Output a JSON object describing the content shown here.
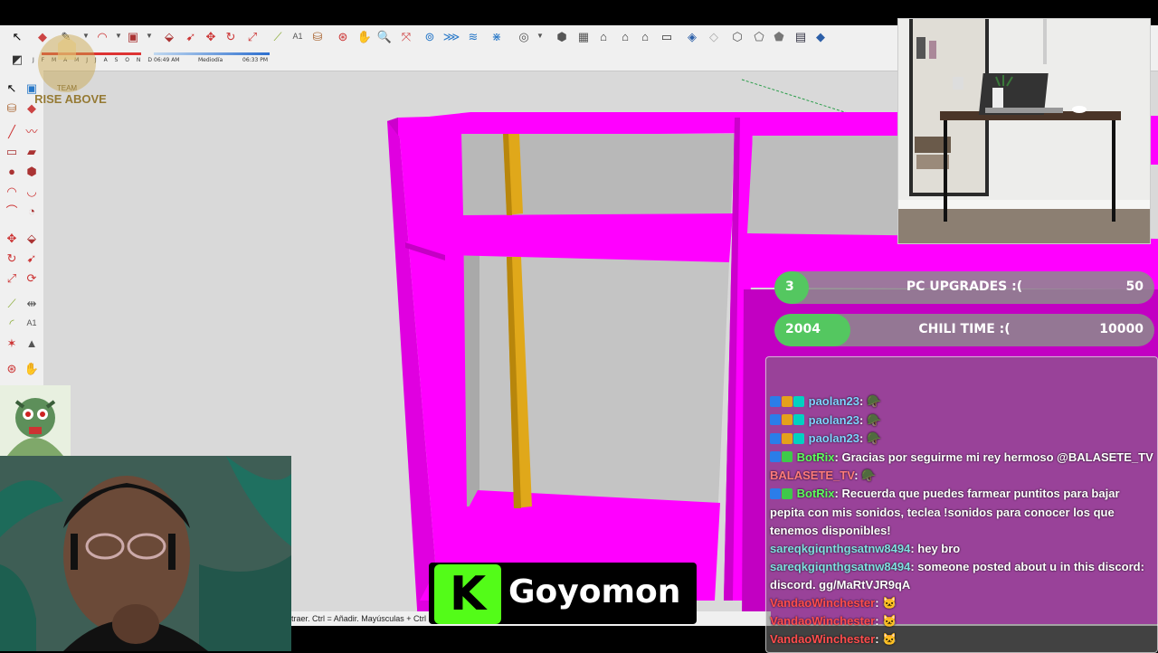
{
  "toolbar": {
    "shadow": {
      "months": "J F M A M J J A S O N D",
      "time_start": "06:49 AM",
      "time_mid": "Mediodía",
      "time_end": "06:33 PM"
    }
  },
  "status_bar": {
    "text": "traer. Ctrl = Añadir. Mayúsculas + Ctrl"
  },
  "overlay": {
    "team_logo": {
      "line1": "TEAM",
      "line2": "RISE ABOVE"
    },
    "goals": [
      {
        "current": "3",
        "title": "PC UPGRADES :(",
        "target": "50",
        "progress": 0.06
      },
      {
        "current": "2004",
        "title": "CHILI TIME :(",
        "target": "10000",
        "progress": 0.2
      }
    ],
    "sponsor": {
      "logo_letter": "K",
      "name": "Goyomon"
    }
  },
  "chat": {
    "messages": [
      {
        "user": "paolan23",
        "text": "",
        "color": "#7fd3ff",
        "badges": [
          "#2b7de9",
          "#e4a11b",
          "#00d1c1"
        ],
        "emote": "🪖"
      },
      {
        "user": "paolan23",
        "text": "",
        "color": "#7fd3ff",
        "badges": [
          "#2b7de9",
          "#e4a11b",
          "#00d1c1"
        ],
        "emote": "🪖"
      },
      {
        "user": "paolan23",
        "text": "",
        "color": "#7fd3ff",
        "badges": [
          "#2b7de9",
          "#e4a11b",
          "#00d1c1"
        ],
        "emote": "🪖"
      },
      {
        "user": "BotRix",
        "text": "Gracias por seguirme mi rey hermoso @BALASETE_TV",
        "color": "#5cff5c",
        "badges": [
          "#2b7de9",
          "#3ec94a"
        ],
        "emote": ""
      },
      {
        "user": "BALASETE_TV",
        "text": "",
        "color": "#ff7b7b",
        "badges": [],
        "emote": "🪖"
      },
      {
        "user": "BotRix",
        "text": "Recuerda que puedes farmear puntitos para bajar pepita con mis sonidos, teclea !sonidos para conocer los que tenemos disponibles!",
        "color": "#5cff5c",
        "badges": [
          "#2b7de9",
          "#3ec94a"
        ],
        "emote": ""
      },
      {
        "user": "sareqkgiqnthgsatnw8494",
        "text": "hey bro",
        "color": "#7fe0e0",
        "badges": [],
        "emote": ""
      },
      {
        "user": "sareqkgiqnthgsatnw8494",
        "text": "someone posted about u in this discord: discord. gg/MaRtVJR9qA",
        "color": "#7fe0e0",
        "badges": [],
        "emote": ""
      },
      {
        "user": "VandaoWinchester",
        "text": "",
        "color": "#ff4d4d",
        "badges": [],
        "emote": "🐱"
      },
      {
        "user": "VandaoWinchester",
        "text": "",
        "color": "#ff4d4d",
        "badges": [],
        "emote": "🐱"
      },
      {
        "user": "VandaoWinchester",
        "text": "",
        "color": "#ff4d4d",
        "badges": [],
        "emote": "🐱"
      }
    ]
  },
  "colors": {
    "material_magenta": "#ff00ff",
    "material_wood": "#e0a81a",
    "goal_fill": "#54c760",
    "kick_green": "#53fc18"
  }
}
